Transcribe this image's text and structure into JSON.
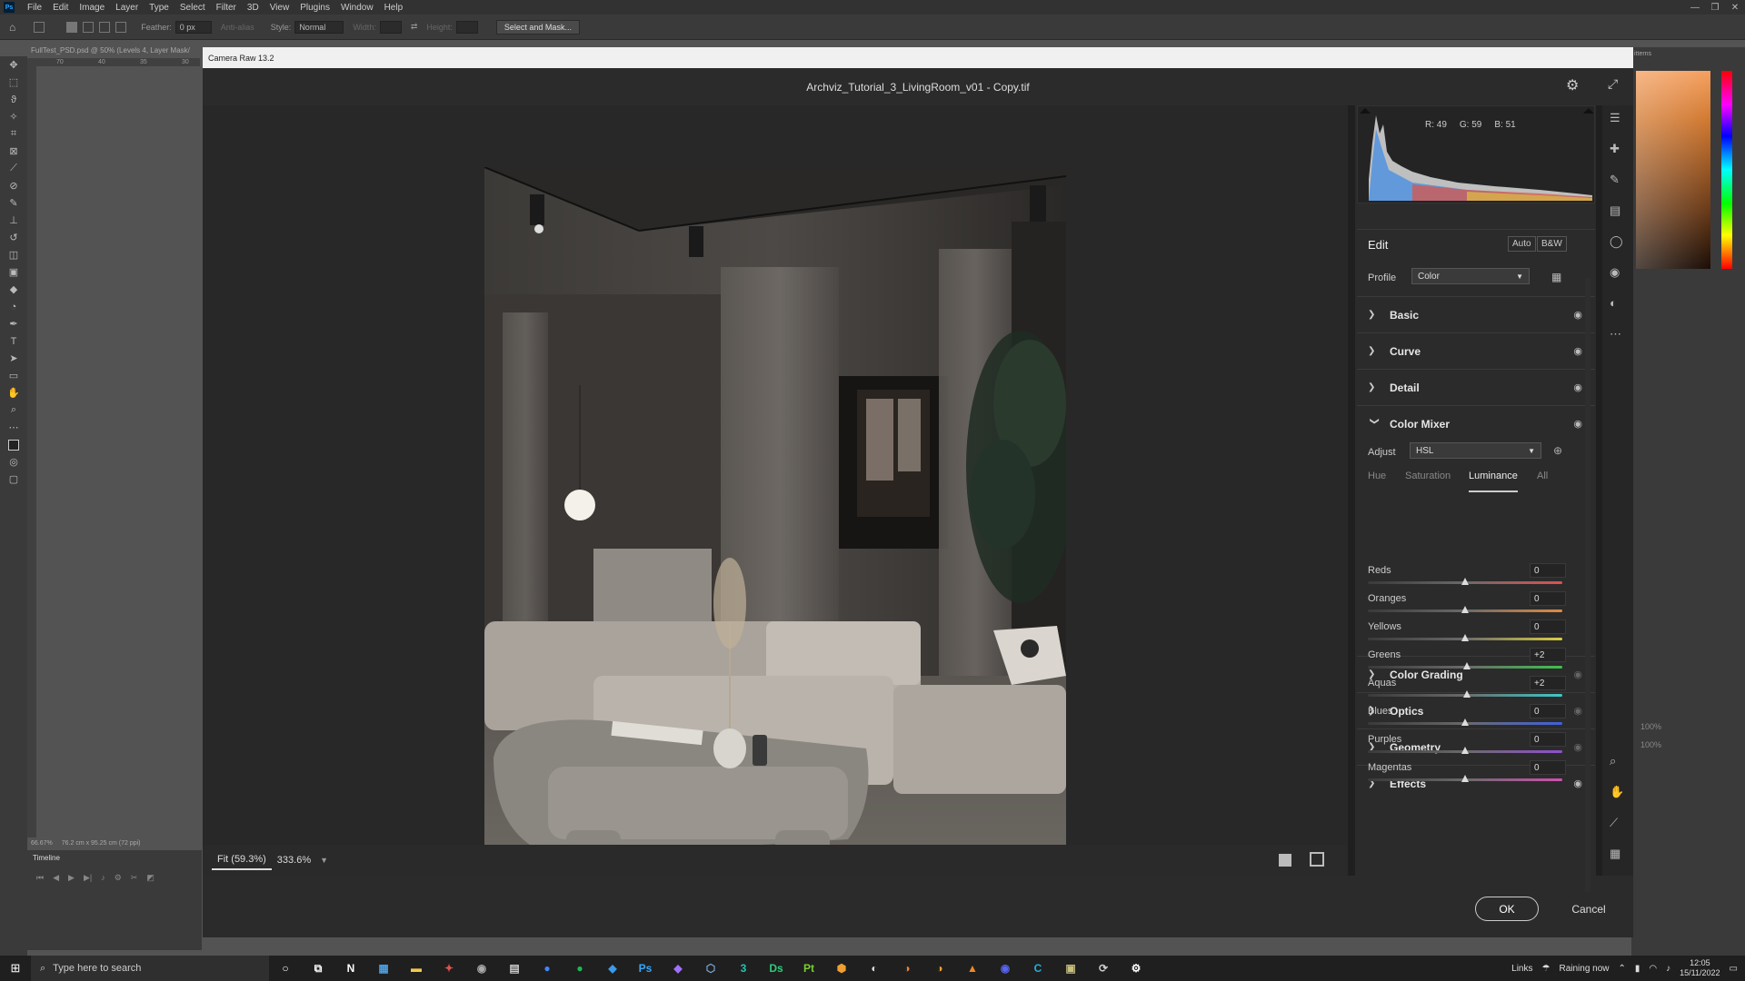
{
  "menubar": {
    "logo": "Ps",
    "items": [
      "File",
      "Edit",
      "Image",
      "Layer",
      "Type",
      "Select",
      "Filter",
      "3D",
      "View",
      "Plugins",
      "Window",
      "Help"
    ],
    "window_controls": [
      "—",
      "❐",
      "✕"
    ]
  },
  "optionsbar": {
    "feather_label": "Feather:",
    "feather_value": "0 px",
    "antialias_label": "Anti-alias",
    "style_label": "Style:",
    "style_value": "Normal",
    "width_label": "Width:",
    "height_label": "Height:",
    "select_mask_label": "Select and Mask..."
  },
  "document_tab": "FullTest_PSD.psd @ 50% (Levels 4, Layer Mask/",
  "ruler_marks": [
    "70",
    "40",
    "35",
    "30"
  ],
  "statusbar": {
    "zoom": "66.67%",
    "size": "76.2 cm x 95.25 cm (72 ppi)"
  },
  "timeline": {
    "title": "Timeline"
  },
  "right_dock": {
    "tab_label": "itterns",
    "value_a": "100%",
    "value_b": "100%"
  },
  "camera_raw": {
    "window_title": "Camera Raw 13.2",
    "file_name": "Archviz_Tutorial_3_LivingRoom_v01 - Copy.tif",
    "histogram": {
      "r": "R: 49",
      "g": "G: 59",
      "b": "B: 51"
    },
    "edit": {
      "title": "Edit",
      "auto": "Auto",
      "bw": "B&W",
      "profile_label": "Profile",
      "profile_value": "Color"
    },
    "sections_top": [
      {
        "title": "Basic"
      },
      {
        "title": "Curve"
      },
      {
        "title": "Detail"
      }
    ],
    "color_mixer": {
      "title": "Color Mixer",
      "adjust_label": "Adjust",
      "adjust_value": "HSL",
      "tabs": [
        "Hue",
        "Saturation",
        "Luminance",
        "All"
      ],
      "active_tab": "Luminance",
      "sliders": [
        {
          "label": "Reds",
          "value": "0",
          "amount": 0,
          "color": "#e05050"
        },
        {
          "label": "Oranges",
          "value": "0",
          "amount": 0,
          "color": "#e08a40"
        },
        {
          "label": "Yellows",
          "value": "0",
          "amount": 0,
          "color": "#d8cf40"
        },
        {
          "label": "Greens",
          "value": "+2",
          "amount": 2,
          "color": "#40c050"
        },
        {
          "label": "Aquas",
          "value": "+2",
          "amount": 2,
          "color": "#40c8c8"
        },
        {
          "label": "Blues",
          "value": "0",
          "amount": 0,
          "color": "#4060e0"
        },
        {
          "label": "Purples",
          "value": "0",
          "amount": 0,
          "color": "#9050d0"
        },
        {
          "label": "Magentas",
          "value": "0",
          "amount": 0,
          "color": "#d050b0"
        }
      ]
    },
    "sections_bottom": [
      {
        "title": "Color Grading"
      },
      {
        "title": "Optics"
      },
      {
        "title": "Geometry"
      },
      {
        "title": "Effects"
      }
    ],
    "zoom_fit": "Fit (59.3%)",
    "zoom_value": "333.6%",
    "ok": "OK",
    "cancel": "Cancel"
  },
  "taskbar": {
    "search_placeholder": "Type here to search",
    "apps": [
      {
        "label": "N",
        "color": "#ffffff"
      },
      {
        "label": "▦",
        "color": "#4aa0e6"
      },
      {
        "label": "▬",
        "color": "#f2c94c"
      },
      {
        "label": "✦",
        "color": "#e0524a"
      },
      {
        "label": "◉",
        "color": "#aaaaaa"
      },
      {
        "label": "▤",
        "color": "#cccccc"
      },
      {
        "label": "●",
        "color": "#4285f4"
      },
      {
        "label": "●",
        "color": "#1db954"
      },
      {
        "label": "◆",
        "color": "#3d9be9"
      },
      {
        "label": "Ps",
        "color": "#31a8ff"
      },
      {
        "label": "◆",
        "color": "#a070ff"
      },
      {
        "label": "⬡",
        "color": "#7aa7d8"
      },
      {
        "label": "3",
        "color": "#1ec8b0"
      },
      {
        "label": "Ds",
        "color": "#2ad07a"
      },
      {
        "label": "Pt",
        "color": "#7ad02a"
      },
      {
        "label": "⬢",
        "color": "#f0a030"
      },
      {
        "label": "◐",
        "color": "#dddddd"
      },
      {
        "label": "◑",
        "color": "#f08030"
      },
      {
        "label": "◑",
        "color": "#f0a030"
      },
      {
        "label": "▲",
        "color": "#f08a20"
      },
      {
        "label": "◉",
        "color": "#5865f2"
      },
      {
        "label": "C",
        "color": "#20b0e0"
      },
      {
        "label": "▣",
        "color": "#c8c080"
      },
      {
        "label": "⟳",
        "color": "#cccccc"
      },
      {
        "label": "⚙",
        "color": "#ffffff"
      }
    ],
    "links": "Links",
    "weather": "Raining now",
    "time": "12:05",
    "date": "15/11/2022"
  }
}
